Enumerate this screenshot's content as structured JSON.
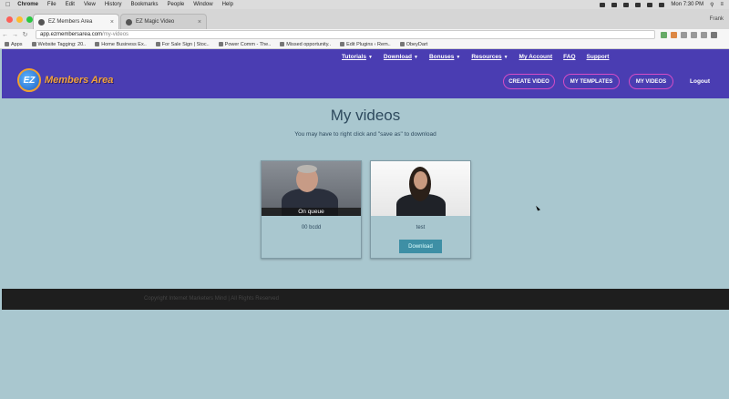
{
  "os_menubar": {
    "app_name": "Chrome",
    "menus": [
      "File",
      "Edit",
      "View",
      "History",
      "Bookmarks",
      "People",
      "Window",
      "Help"
    ],
    "clock": "Mon 7:30 PM"
  },
  "browser": {
    "user": "Frank",
    "tabs": [
      {
        "title": "EZ Members Area",
        "active": true
      },
      {
        "title": "EZ Magic Video",
        "active": false
      }
    ],
    "url": {
      "host": "app.ezmembersarea.com",
      "path": "/my-videos"
    },
    "bookmarks": [
      "Apps",
      "Website Tagging: 20..",
      "Home Business Ex..",
      "For Sale Sign | Stoc..",
      "Power Comm - The..",
      "Missed opportunity..",
      "Edit Plugins ‹ Rem..",
      "ObeyDart"
    ]
  },
  "site": {
    "logo_badge": "EZ",
    "logo_text": "Members Area",
    "nav": [
      {
        "label": "Tutorials",
        "dropdown": true
      },
      {
        "label": "Download",
        "dropdown": true
      },
      {
        "label": "Bonuses",
        "dropdown": true
      },
      {
        "label": "Resources",
        "dropdown": true
      },
      {
        "label": "My Account",
        "dropdown": false
      },
      {
        "label": "FAQ",
        "dropdown": false
      },
      {
        "label": "Support",
        "dropdown": false
      }
    ],
    "buttons": {
      "create_video": "CREATE VIDEO",
      "my_templates": "MY TEMPLATES",
      "my_videos": "MY VIDEOS",
      "logout": "Logout"
    }
  },
  "main": {
    "title": "My videos",
    "subtitle": "You may have to right click and \"save as\" to download",
    "videos": [
      {
        "status_overlay": "On queue",
        "label": "00 bcdd",
        "download_label": ""
      },
      {
        "status_overlay": "",
        "label": "test",
        "download_label": "Download"
      }
    ]
  },
  "footer": {
    "copyright": "Copyright Internet Marketers Mind  |  All Rights Reserved"
  },
  "colors": {
    "header_bg": "#4a3db2",
    "page_bg": "#a9c7cf",
    "accent_pill": "#d44cc6",
    "download_bg": "#3e8fa5",
    "footer_bg": "#1e1e1e"
  }
}
